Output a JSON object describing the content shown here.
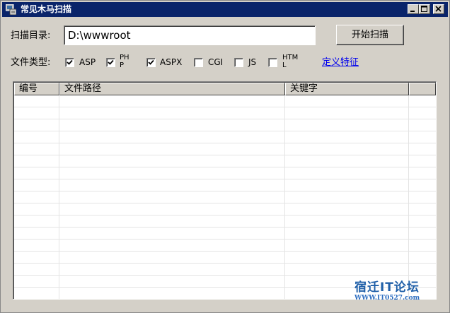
{
  "window": {
    "title": "常见木马扫描"
  },
  "form": {
    "dir_label": "扫描目录:",
    "dir_value": "D:\\wwwroot",
    "start_button": "开始扫描",
    "type_label": "文件类型:",
    "file_types": [
      {
        "label": "ASP",
        "checked": true
      },
      {
        "label": "PHP",
        "checked": true
      },
      {
        "label": "ASPX",
        "checked": true
      },
      {
        "label": "CGI",
        "checked": false
      },
      {
        "label": "JS",
        "checked": false
      },
      {
        "label": "HTML",
        "checked": false
      }
    ],
    "define_link": "定义特征"
  },
  "table": {
    "columns": [
      "编号",
      "文件路径",
      "关键字",
      ""
    ]
  },
  "watermark": {
    "title": "宿迁IT论坛",
    "url": "WWW.IT0527.com"
  },
  "colors": {
    "titlebar": "#0a246a",
    "face": "#d4d0c8",
    "link": "#0000ee",
    "watermark": "#1f5fa8"
  },
  "icons": [
    "app-icon",
    "minimize-icon",
    "maximize-icon",
    "close-icon",
    "checkmark-icon"
  ]
}
